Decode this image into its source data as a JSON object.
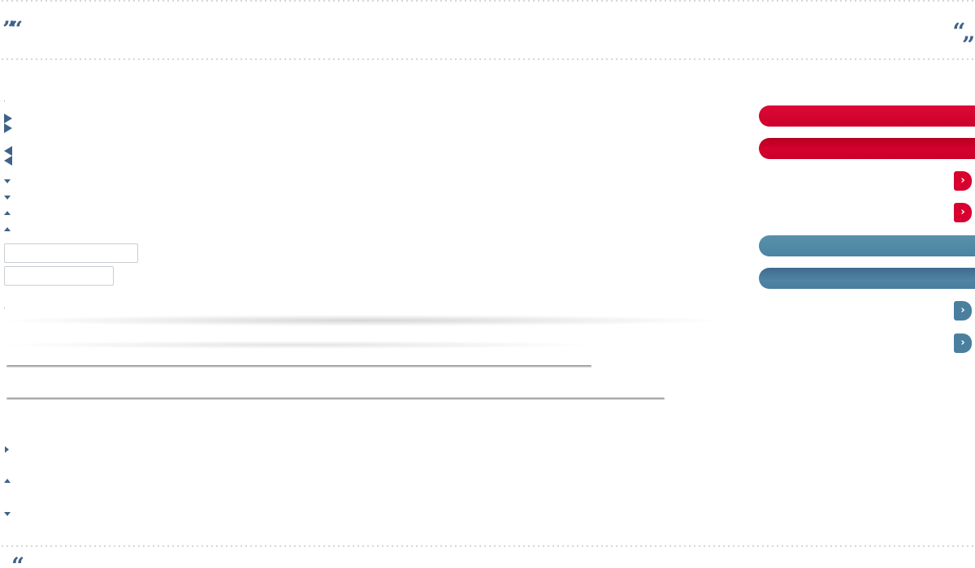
{
  "quotes": {
    "top_left": "”“",
    "top_right_open": "”",
    "top_right_close": "”",
    "bottom_left": "“"
  },
  "fields": {
    "field_1_value": "",
    "field_2_value": ""
  },
  "buttons": {
    "red_pill_1": "",
    "red_pill_2": "",
    "red_chevron": "›",
    "blue_pill_1": "",
    "blue_pill_2": "",
    "blue_chevron": "›"
  },
  "colors": {
    "accent_blue": "#3f6287",
    "red": "#d8002f",
    "steel_blue": "#4a7f9f"
  },
  "icons": [
    "quote-icon",
    "triangle-right-icon",
    "triangle-left-icon",
    "triangle-down-icon",
    "triangle-up-icon",
    "chevron-right-icon"
  ]
}
